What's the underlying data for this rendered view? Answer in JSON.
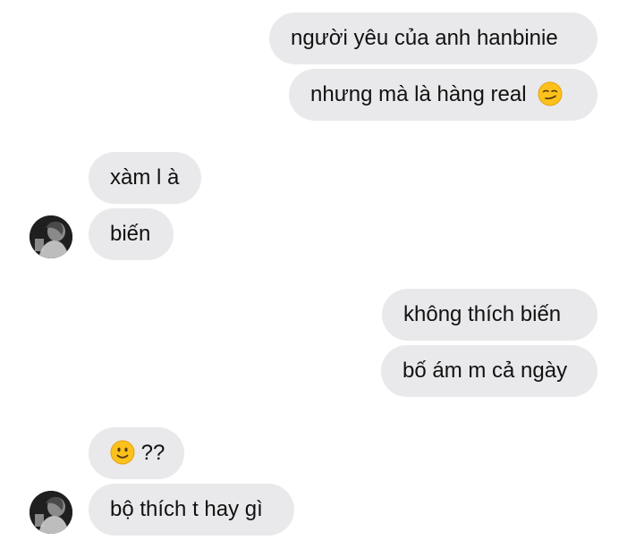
{
  "messages": [
    {
      "id": "m1",
      "side": "sent",
      "text": "người yêu của anh hanbinie",
      "emoji": ""
    },
    {
      "id": "m2",
      "side": "sent",
      "text": "nhưng mà là hàng real",
      "emoji": "smirk-emoji"
    },
    {
      "id": "m3",
      "side": "received",
      "text": "xàm l à",
      "emoji": ""
    },
    {
      "id": "m4",
      "side": "received",
      "text": "biến",
      "emoji": ""
    },
    {
      "id": "m5",
      "side": "sent",
      "text": "không thích biến",
      "emoji": ""
    },
    {
      "id": "m6",
      "side": "sent",
      "text": "bố ám m cả ngày",
      "emoji": ""
    },
    {
      "id": "m7",
      "side": "received",
      "text": "??",
      "emoji": "slight-smile-emoji"
    },
    {
      "id": "m8",
      "side": "received",
      "text": "bộ thích t hay gì",
      "emoji": ""
    }
  ],
  "colors": {
    "bubble_bg": "#e9e9eb",
    "text": "#111111",
    "emoji_face": "#fcc21b"
  },
  "icons": {
    "avatar": "contact-avatar"
  }
}
